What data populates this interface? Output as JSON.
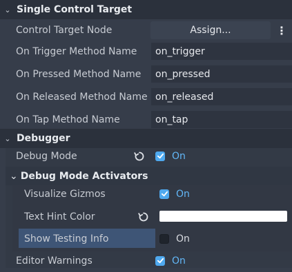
{
  "sections": {
    "single_control_target": {
      "title": "Single Control Target"
    },
    "debugger": {
      "title": "Debugger"
    },
    "debug_mode_activators": {
      "title": "Debug Mode Activators"
    }
  },
  "properties": {
    "control_target_node": {
      "label": "Control Target Node",
      "button": "Assign...",
      "menu_icon": "kebab-menu-icon"
    },
    "on_trigger": {
      "label": "On Trigger Method Name",
      "value": "on_trigger"
    },
    "on_pressed": {
      "label": "On Pressed Method Name",
      "value": "on_pressed"
    },
    "on_released": {
      "label": "On Released Method Name",
      "value": "on_released"
    },
    "on_tap": {
      "label": "On Tap Method Name",
      "value": "on_tap"
    },
    "debug_mode": {
      "label": "Debug Mode",
      "state": "On"
    },
    "visualize_gizmos": {
      "label": "Visualize Gizmos",
      "state": "On"
    },
    "text_hint_color": {
      "label": "Text Hint Color",
      "color": "#ffffff"
    },
    "show_testing_info": {
      "label": "Show Testing Info",
      "state": "On"
    },
    "editor_warnings": {
      "label": "Editor Warnings",
      "state": "On"
    }
  },
  "colors": {
    "accent": "#4fa9ef",
    "selected_row": "#3e5576",
    "background": "#363d4a"
  }
}
